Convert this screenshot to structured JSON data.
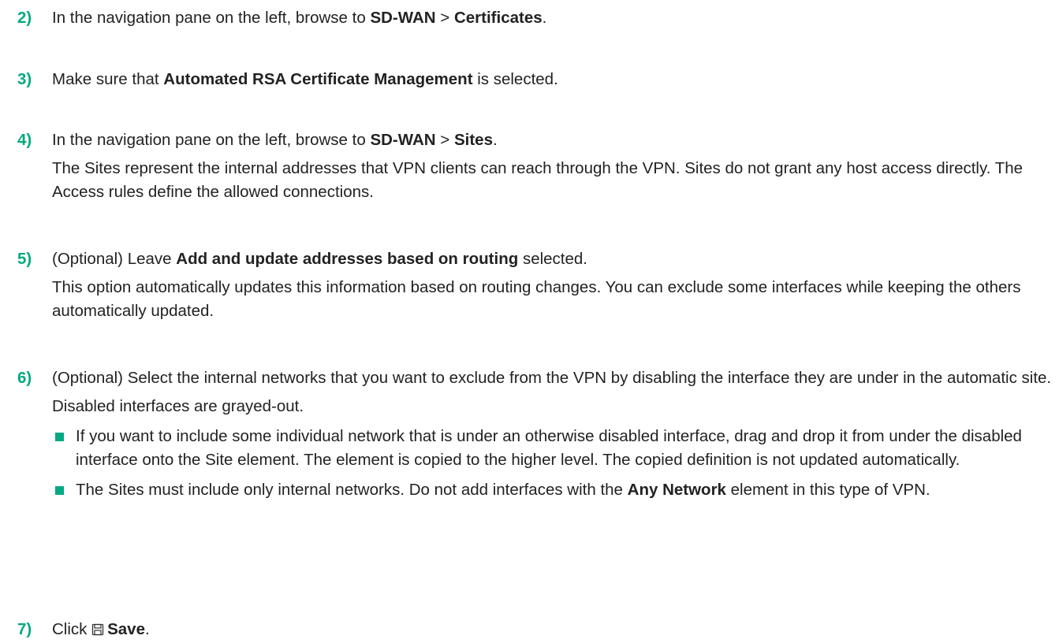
{
  "steps": [
    {
      "num": "2)",
      "line_a": "In the navigation pane on the left, browse to ",
      "bold_a": "SD-WAN",
      "sep": " > ",
      "bold_b": "Certificates",
      "end": "."
    },
    {
      "num": "3)",
      "line_a": "Make sure that ",
      "bold_a": "Automated RSA Certificate Management",
      "end": " is selected."
    },
    {
      "num": "4)",
      "line_a": "In the navigation pane on the left, browse to ",
      "bold_a": "SD-WAN",
      "sep": " > ",
      "bold_b": "Sites",
      "end": ".",
      "para": "The Sites represent the internal addresses that VPN clients can reach through the VPN. Sites do not grant any host access directly. The Access rules define the allowed connections."
    },
    {
      "num": "5)",
      "line_a": "(Optional) Leave ",
      "bold_a": "Add and update addresses based on routing",
      "end": " selected.",
      "para": "This option automatically updates this information based on routing changes. You can exclude some interfaces while keeping the others automatically updated."
    },
    {
      "num": "6)",
      "line_a": "(Optional) Select the internal networks that you want to exclude from the VPN by disabling the interface they are under in the automatic site.",
      "para": "Disabled interfaces are grayed-out.",
      "bullets": [
        {
          "text_a": "If you want to include some individual network that is under an otherwise disabled interface, drag and drop it from under the disabled interface onto the Site element. The element is copied to the higher level. The copied definition is not updated automatically."
        },
        {
          "text_a": "The Sites must include only internal networks. Do not add interfaces with the ",
          "bold": "Any Network",
          "text_b": " element in this type of VPN."
        }
      ]
    },
    {
      "num": "7)",
      "line_a": "Click ",
      "icon": "save-icon",
      "bold_a": "Save",
      "end": "."
    }
  ],
  "colors": {
    "accent": "#01a982",
    "text": "#222222"
  }
}
